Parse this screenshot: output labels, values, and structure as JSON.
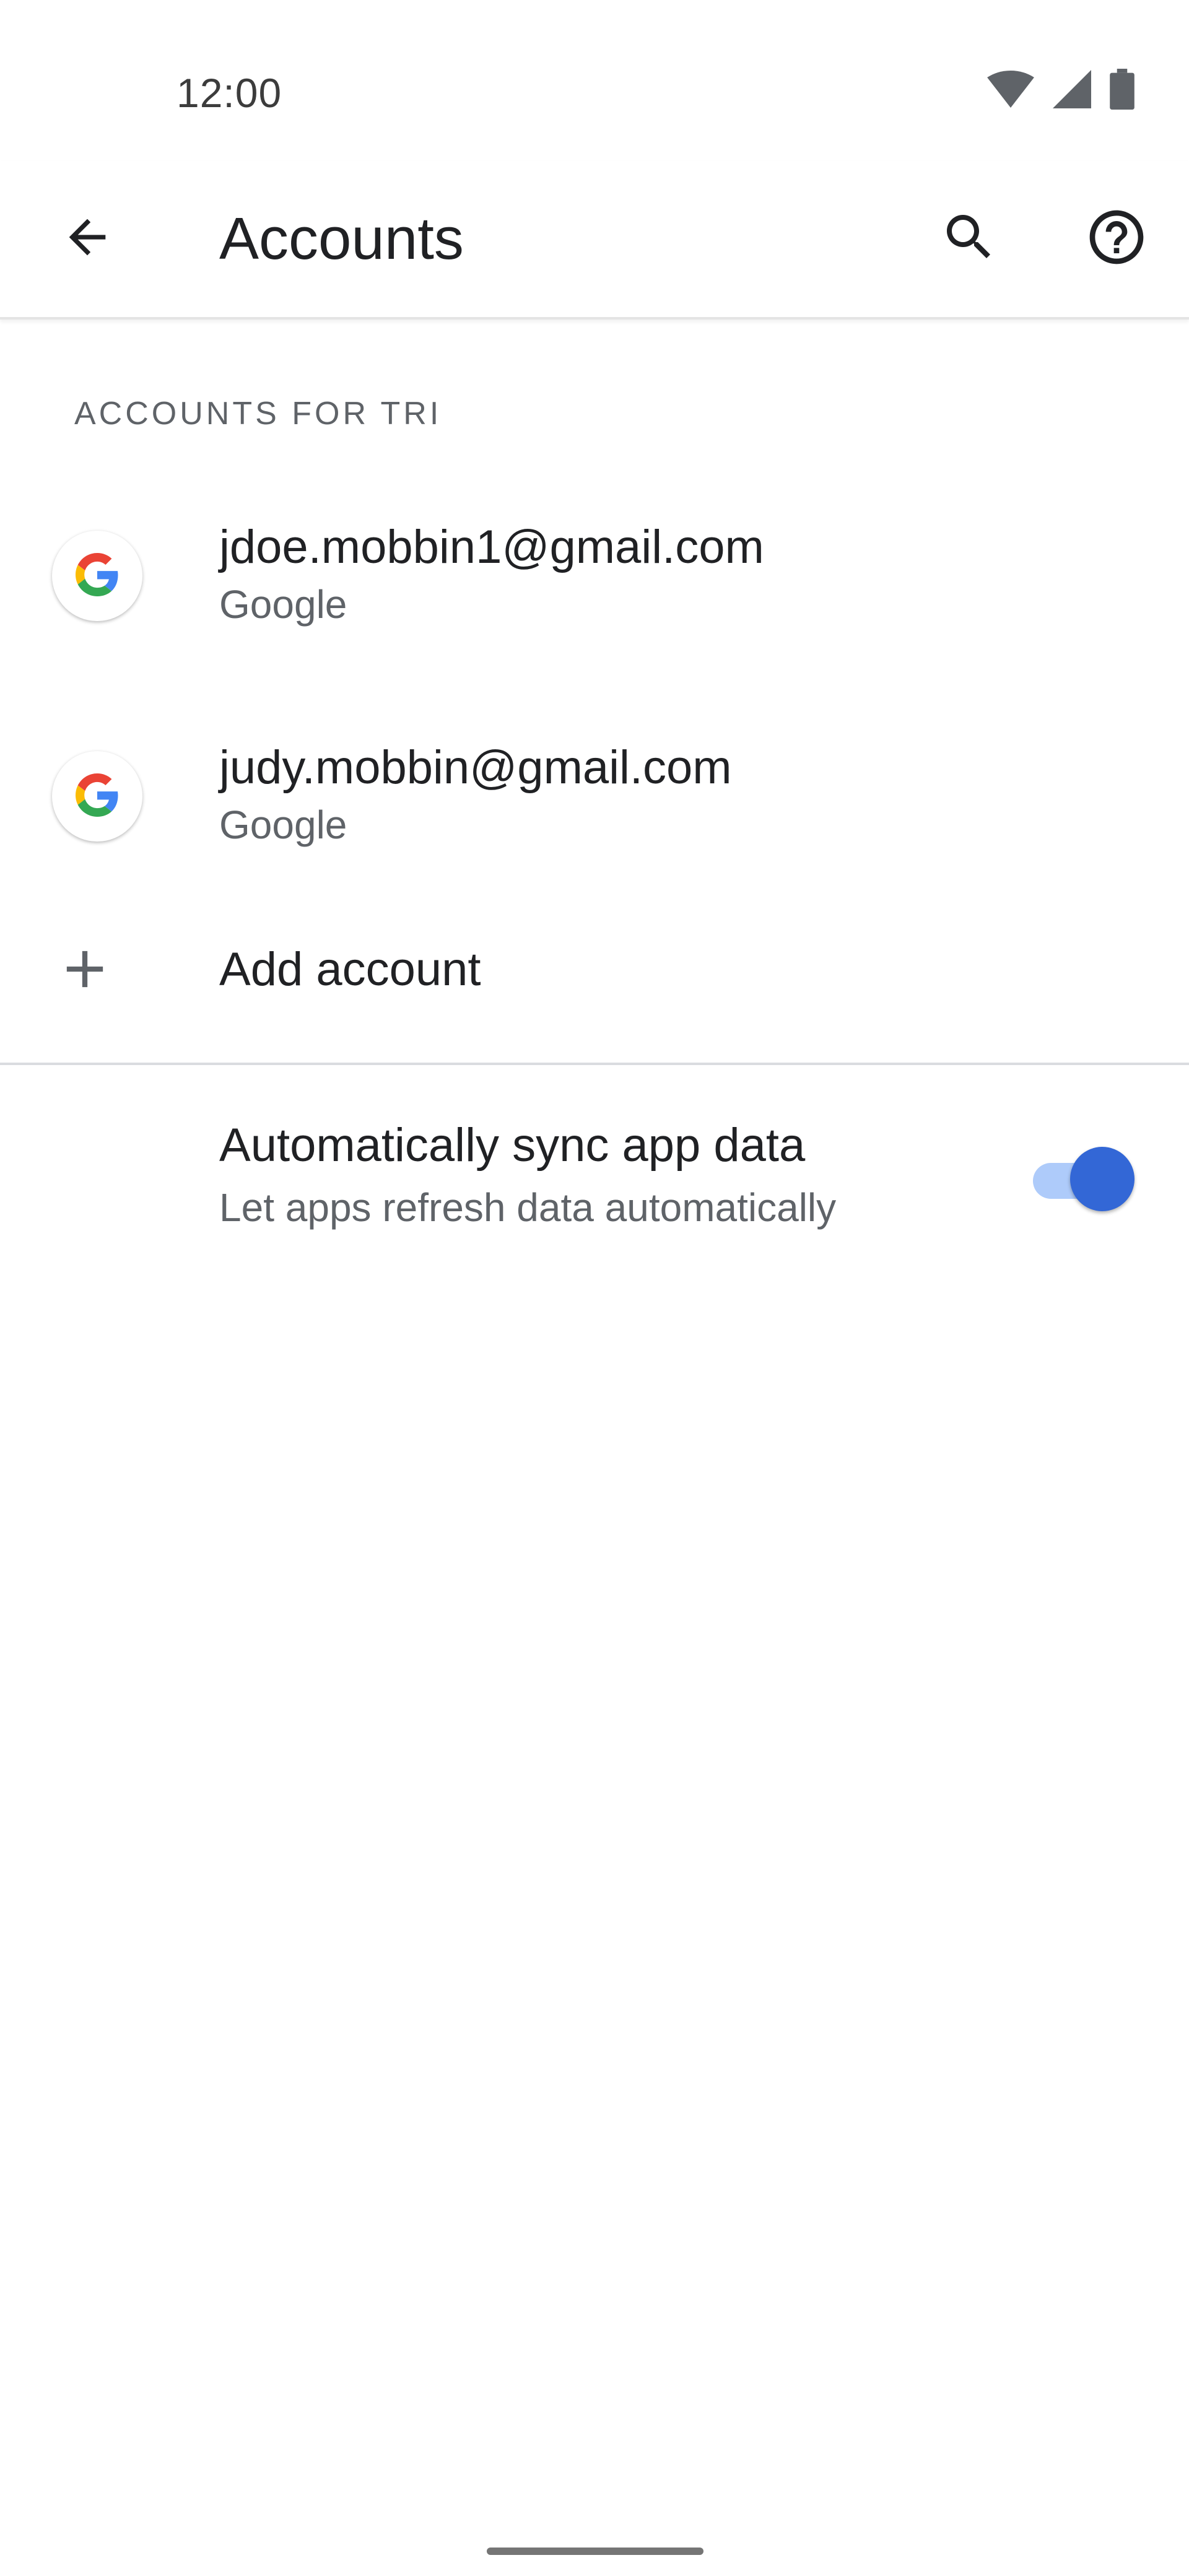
{
  "status_bar": {
    "time": "12:00",
    "icons": [
      "wifi-icon",
      "cell-signal-icon",
      "battery-icon"
    ]
  },
  "app_bar": {
    "title": "Accounts",
    "back_icon": "arrow-back-icon",
    "search_icon": "search-icon",
    "help_icon": "help-circle-icon"
  },
  "section": {
    "header": "ACCOUNTS FOR TRI"
  },
  "accounts": [
    {
      "email": "jdoe.mobbin1@gmail.com",
      "provider": "Google",
      "icon": "google-logo-icon"
    },
    {
      "email": "judy.mobbin@gmail.com",
      "provider": "Google",
      "icon": "google-logo-icon"
    }
  ],
  "add_account": {
    "label": "Add account",
    "icon": "plus-icon"
  },
  "sync": {
    "title": "Automatically sync app data",
    "subtitle": "Let apps refresh data automatically",
    "enabled": true
  },
  "colors": {
    "accent": "#3367d6",
    "toggle_track": "#aecbfa",
    "text_primary": "#202124",
    "text_secondary": "#5f6368",
    "divider": "#dadce0"
  }
}
